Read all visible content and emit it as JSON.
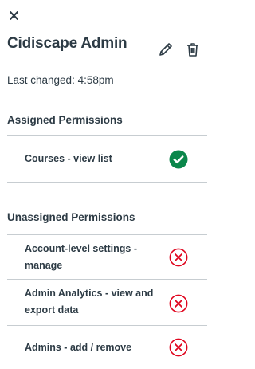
{
  "header": {
    "title": "Cidiscape Admin",
    "close_icon": "close-icon",
    "edit_icon": "pencil-icon",
    "delete_icon": "trash-icon"
  },
  "last_changed": "Last changed: 4:58pm",
  "assigned": {
    "heading": "Assigned Permissions",
    "items": [
      {
        "label": "Courses - view list",
        "status": "granted",
        "icon": "check-circle-icon"
      }
    ]
  },
  "unassigned": {
    "heading": "Unassigned Permissions",
    "items": [
      {
        "label": "Account-level settings - manage",
        "status": "denied",
        "icon": "x-circle-icon"
      },
      {
        "label": "Admin Analytics - view and export data",
        "status": "denied",
        "icon": "x-circle-icon"
      },
      {
        "label": "Admins - add / remove",
        "status": "denied",
        "icon": "x-circle-icon"
      }
    ]
  },
  "colors": {
    "granted": "#0b874b",
    "denied": "#e0061f",
    "text": "#2d3b45",
    "divider": "#c7cdd1"
  }
}
